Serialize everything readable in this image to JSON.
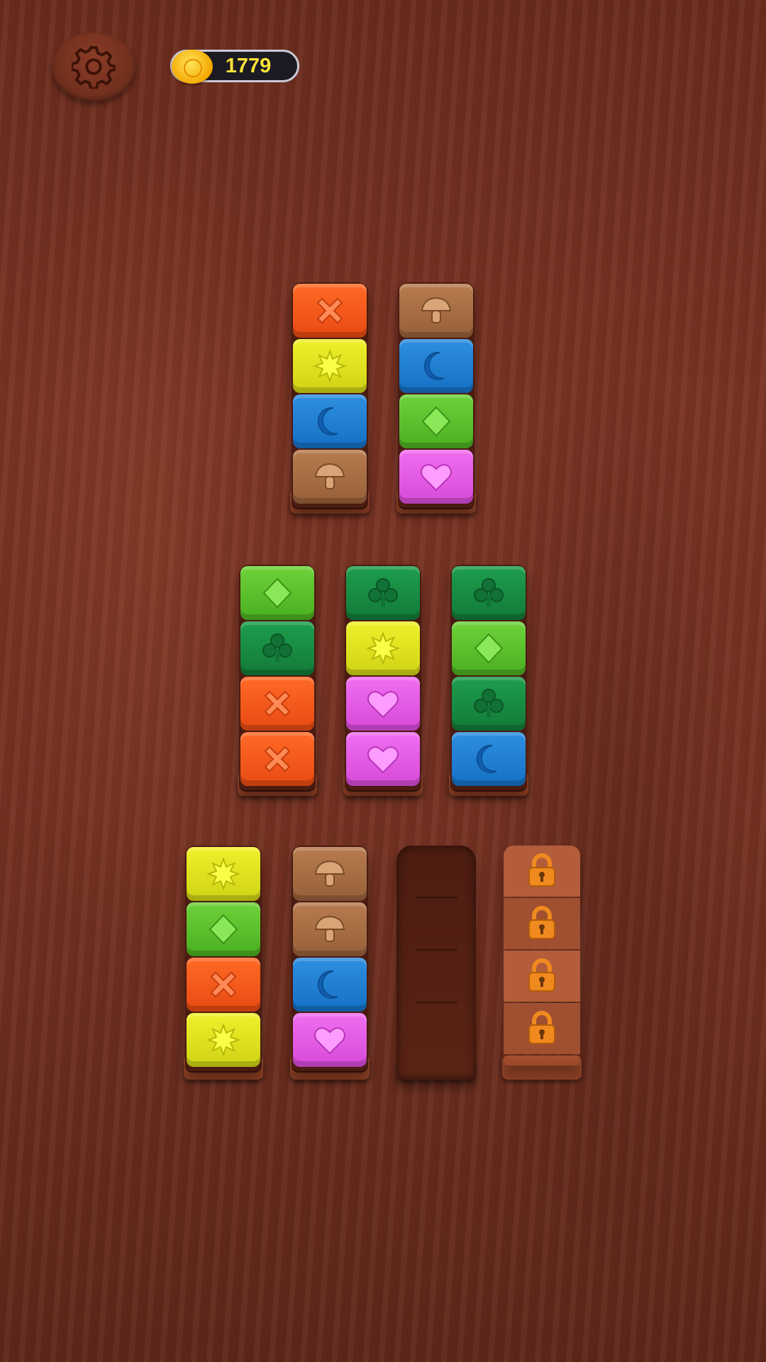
{
  "hud": {
    "settings_icon": "gear-icon",
    "coin_icon": "coin-icon",
    "coins": "1779"
  },
  "colors": {
    "orange": "#f25a1c",
    "yellow": "#e2e324",
    "blue": "#2381d6",
    "brown": "#a66e44",
    "lime": "#5cc12c",
    "dark_green": "#178a43",
    "pink": "#e35ce5",
    "lock": "#f08a1e"
  },
  "tubes_top_to_bottom_blocks": [
    [
      "orange-cross",
      "yellow-star",
      "blue-moon",
      "brown-mushroom"
    ],
    [
      "brown-mushroom",
      "blue-moon",
      "lime-diamond",
      "pink-heart"
    ],
    [
      "lime-diamond",
      "dgreen-club",
      "orange-cross",
      "orange-cross"
    ],
    [
      "dgreen-club",
      "yellow-star",
      "pink-heart",
      "pink-heart"
    ],
    [
      "dgreen-club",
      "lime-diamond",
      "dgreen-club",
      "blue-moon"
    ],
    [
      "yellow-star",
      "lime-diamond",
      "orange-cross",
      "yellow-star"
    ],
    [
      "brown-mushroom",
      "brown-mushroom",
      "blue-moon",
      "pink-heart"
    ],
    [],
    [
      "locked",
      "locked",
      "locked",
      "locked"
    ]
  ]
}
